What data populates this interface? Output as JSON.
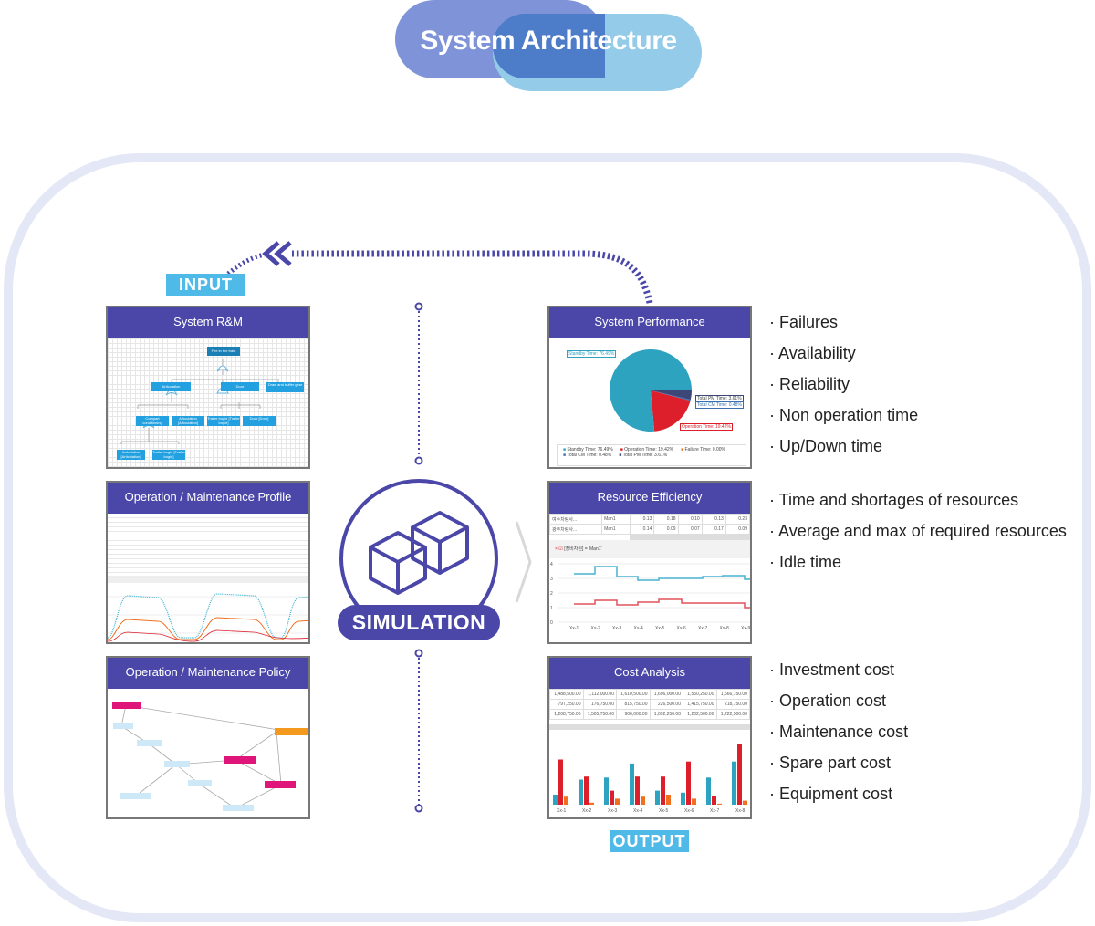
{
  "title": "System Architecture",
  "input_label": "INPUT",
  "output_label": "OUTPUT",
  "simulation_label": "SIMULATION",
  "colors": {
    "header": "#4a47a9",
    "tag": "#4fb9e8",
    "frame": "#e4e8f6",
    "pill_left": "#7f93d8",
    "pill_right": "#93cbe8"
  },
  "inputs": [
    {
      "title": "System R&M",
      "nodes": [
        "Fire in the train",
        "Articulation",
        "Door",
        "Draw and buffer gear",
        "Compart conditioning",
        "Articulation [Articulation]",
        "Trailer bogie [Trailer bogie]",
        "Door [Door]",
        "Articulation [Articulation]",
        "Trailer bogie [Trailer bogie]"
      ]
    },
    {
      "title": "Operation / Maintenance Profile"
    },
    {
      "title": "Operation / Maintenance Policy"
    }
  ],
  "outputs": [
    {
      "title": "System Performance",
      "pie": [
        {
          "label": "Standby Time: 76.49%",
          "value": 76.49,
          "color": "#2ea3c0"
        },
        {
          "label": "Operation Time: 19.42%",
          "value": 19.42,
          "color": "#dc1f2b"
        },
        {
          "label": "Failure Time: 0.00%",
          "value": 0,
          "color": "#f07020"
        },
        {
          "label": "Total CM Time: 0.48%",
          "value": 0.48,
          "color": "#3a6fb0"
        },
        {
          "label": "Total PM Time: 3.61%",
          "value": 3.61,
          "color": "#3d4777"
        }
      ],
      "items": [
        "Failures",
        "Availability",
        "Reliability",
        "Non operation time",
        "Up/Down time"
      ]
    },
    {
      "title": "Resource Efficiency",
      "rows": [
        [
          "여수차량사...",
          "Man1",
          "0.13",
          "0.18",
          "0.10",
          "0.13",
          "0.23"
        ],
        [
          "광주차량사...",
          "Man1",
          "0.14",
          "0.09",
          "0.07",
          "0.17",
          "0.09"
        ]
      ],
      "filter": "[정비자원] = 'Man1'",
      "x_labels": [
        "Xx-1",
        "Xx-2",
        "Xx-3",
        "Xx-4",
        "Xx-5",
        "Xx-6",
        "Xx-7",
        "Xx-8",
        "Xx-9"
      ],
      "y_labels": [
        "4",
        "3",
        "2",
        "1",
        "0"
      ],
      "items": [
        "Time and shortages of resources",
        "Average and max of required resources",
        "Idle time"
      ]
    },
    {
      "title": "Cost Analysis",
      "rows": [
        [
          "1,488,500.00",
          "1,112,000.00",
          "1,610,500.00",
          "1,696,000.00",
          "1,550,250.00",
          "1,566,750.00"
        ],
        [
          "797,250.00",
          "176,750.00",
          "815,750.00",
          "226,500.00",
          "1,415,750.00",
          "218,750.00"
        ],
        [
          "1,208,750.00",
          "1,505,750.00",
          "906,000.00",
          "1,092,250.00",
          "1,202,500.00",
          "1,222,500.00"
        ]
      ],
      "x_labels": [
        "Xx-1",
        "Xx-2",
        "Xx-3",
        "Xx-4",
        "Xx-5",
        "Xx-6",
        "Xx-7",
        "Xx-8"
      ],
      "items": [
        "Investment cost",
        "Operation cost",
        "Maintenance cost",
        "Spare part cost",
        "Equipment cost"
      ]
    }
  ]
}
